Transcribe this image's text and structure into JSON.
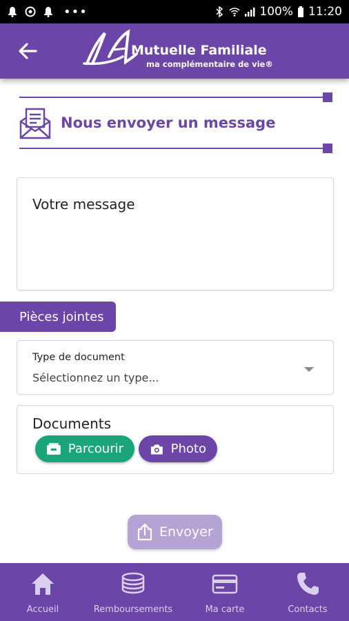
{
  "status_bar": {
    "battery": "100%",
    "time": "11:20",
    "icons": [
      "notification-icon",
      "location-icon",
      "notification-icon",
      "more-icon",
      "bluetooth-icon",
      "wifi-icon",
      "signal-icon",
      "battery-icon"
    ]
  },
  "app_bar": {
    "back_icon": "arrow-left-icon",
    "logo_title": "Mutuelle Familiale",
    "logo_subtitle": "ma complémentaire de vie®"
  },
  "section": {
    "title": "Nous envoyer un message",
    "icon": "mail-icon"
  },
  "message": {
    "placeholder": "Votre message"
  },
  "attachments": {
    "tab_label": "Pièces jointes",
    "doc_type_label": "Type de document",
    "doc_type_value": "Sélectionnez un type...",
    "documents_label": "Documents",
    "browse_button": "Parcourir",
    "photo_button": "Photo"
  },
  "actions": {
    "send_button": "Envoyer"
  },
  "bottom_nav": {
    "items": [
      {
        "label": "Accueil",
        "icon": "home-icon"
      },
      {
        "label": "Remboursements",
        "icon": "coins-icon"
      },
      {
        "label": "Ma carte",
        "icon": "card-icon"
      },
      {
        "label": "Contacts",
        "icon": "phone-icon"
      }
    ]
  },
  "colors": {
    "primary": "#6c45a8",
    "green": "#1aa57a",
    "disabled_button": "#b6a3d6"
  }
}
